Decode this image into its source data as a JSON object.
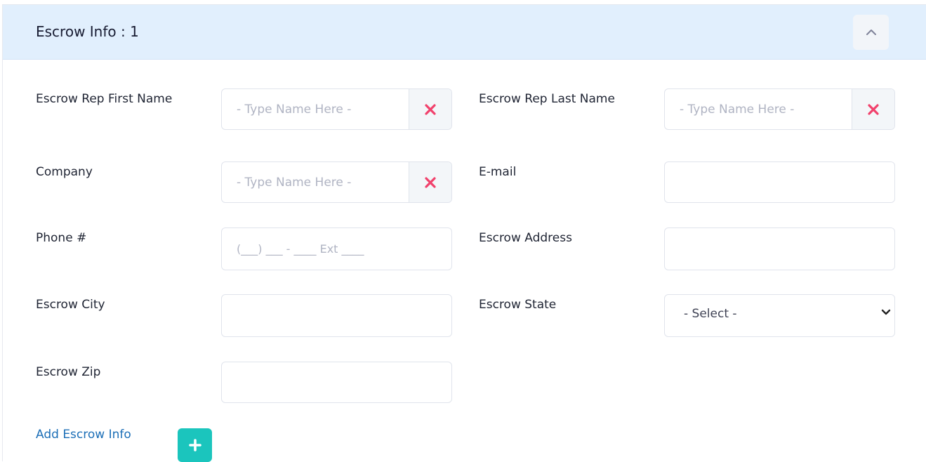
{
  "section": {
    "title": "Escrow Info : 1"
  },
  "fields": {
    "first_name": {
      "label": "Escrow Rep First Name",
      "placeholder": "- Type Name Here -"
    },
    "last_name": {
      "label": "Escrow Rep Last Name",
      "placeholder": "- Type Name Here -"
    },
    "company": {
      "label": "Company",
      "placeholder": "- Type Name Here -"
    },
    "email": {
      "label": "E-mail"
    },
    "phone": {
      "label": "Phone #",
      "placeholder": "(___) ___ - ____ Ext ____"
    },
    "address": {
      "label": "Escrow Address"
    },
    "city": {
      "label": "Escrow City"
    },
    "state": {
      "label": "Escrow State",
      "selected": "- Select -"
    },
    "zip": {
      "label": "Escrow Zip"
    }
  },
  "actions": {
    "add_label": "Add Escrow Info"
  },
  "colors": {
    "header_bg": "#e1effd",
    "clear_icon": "#f1416c",
    "add_button": "#1bc5bd",
    "link": "#1c6fb7"
  },
  "icons": {
    "collapse": "chevron-up-icon",
    "clear": "close-x-icon",
    "add": "plus-icon",
    "select": "chevron-down-icon"
  }
}
